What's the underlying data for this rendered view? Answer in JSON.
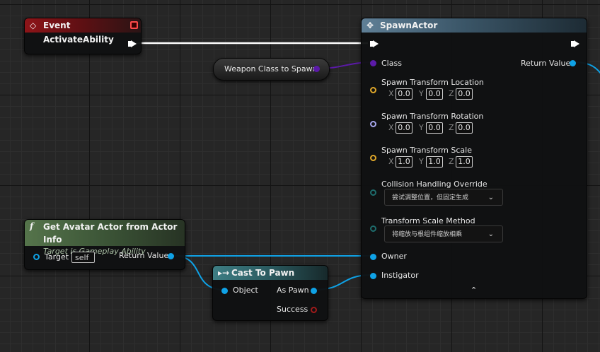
{
  "event_node": {
    "title": "Event ActivateAbility",
    "icon": "event-diamond-icon"
  },
  "spawn_node": {
    "title": "SpawnActor",
    "icon": "spawn-actor-icon",
    "pins": {
      "class": "Class",
      "return_value": "Return Value",
      "location": "Spawn Transform Location",
      "rotation": "Spawn Transform Rotation",
      "scale": "Spawn Transform Scale",
      "collision": "Collision Handling Override",
      "scale_method": "Transform Scale Method",
      "owner": "Owner",
      "instigator": "Instigator"
    },
    "location": {
      "x": "0.0",
      "y": "0.0",
      "z": "0.0"
    },
    "rotation": {
      "x": "0.0",
      "y": "0.0",
      "z": "0.0"
    },
    "scale": {
      "x": "1.0",
      "y": "1.0",
      "z": "1.0"
    },
    "axis": {
      "x": "X",
      "y": "Y",
      "z": "Z"
    },
    "collision_value": "尝试调整位置，但固定生成",
    "scale_method_value": "将缩放与根组件缩放相乘"
  },
  "weapon_var": {
    "label": "Weapon Class to Spawn"
  },
  "avatar_node": {
    "title": "Get Avatar Actor from Actor Info",
    "subtitle": "Target is Gameplay Ability",
    "icon": "function-f-icon",
    "target_label": "Target",
    "target_value": "self",
    "return_label": "Return Value"
  },
  "cast_node": {
    "title": "Cast To Pawn",
    "icon": "cast-icon",
    "object_label": "Object",
    "as_pawn_label": "As Pawn",
    "success_label": "Success"
  },
  "colors": {
    "exec": "#ffffff",
    "object": "#0fa2e6",
    "class": "#5b1aa8",
    "vector": "#e0a82a",
    "rotator": "#a7a7ee",
    "enum": "#1e6c6c",
    "bool": "#a11b1b"
  }
}
